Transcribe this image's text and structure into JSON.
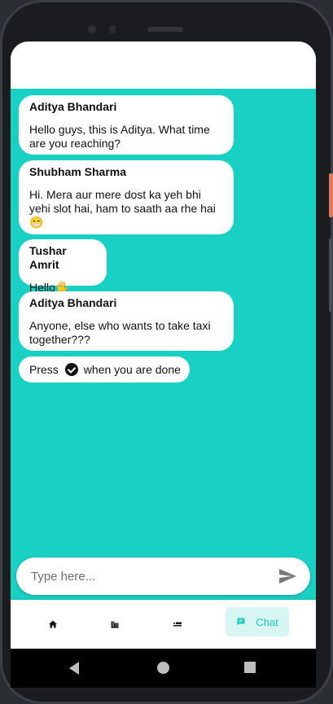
{
  "messages": [
    {
      "author": "Aditya Bhandari",
      "text": "Hello guys, this is Aditya. What time are you reaching?"
    },
    {
      "author": "Shubham Sharma",
      "text": "Hi. Mera aur mere dost ka yeh bhi yehi slot hai, ham to saath aa rhe hai 😁"
    },
    {
      "author": "Tushar Amrit",
      "text": "Hello🖐"
    },
    {
      "author": "Aditya Bhandari",
      "text": "Anyone, else who wants to take taxi together???"
    }
  ],
  "hint": {
    "before": "Press",
    "after": "when you are done",
    "icon": "check-circle-icon"
  },
  "composer": {
    "placeholder": "Type here...",
    "send_icon": "send-icon"
  },
  "bottom_nav": {
    "items": [
      {
        "icon": "home-icon"
      },
      {
        "icon": "building-icon"
      },
      {
        "icon": "taxi-icon"
      },
      {
        "icon": "chat-icon",
        "label": "Chat",
        "active": true
      }
    ]
  },
  "colors": {
    "accent": "#18d0c4",
    "active_bg": "#d7f6f3",
    "active_fg": "#18c8bc"
  }
}
